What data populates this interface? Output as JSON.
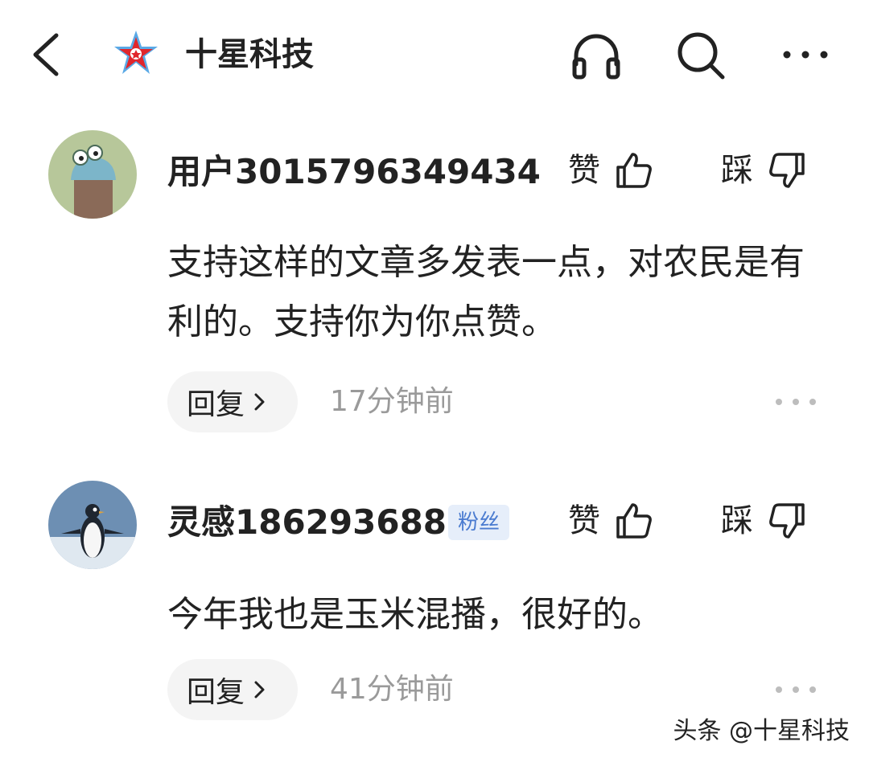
{
  "header": {
    "channel_name": "十星科技",
    "icons": [
      "back-arrow-icon",
      "channel-logo-star",
      "headphones-icon",
      "search-icon",
      "more-dots-icon"
    ]
  },
  "comments": [
    {
      "username": "用户3015796349434",
      "badge": "",
      "like_label": "赞",
      "dislike_label": "踩",
      "text": "支持这样的文章多发表一点，对农民是有利的。支持你为你点赞。",
      "reply_label": "回复",
      "time": "17分钟前",
      "avatar": "cartoon-creature-avatar"
    },
    {
      "username": "灵感186293688",
      "badge": "粉丝",
      "like_label": "赞",
      "dislike_label": "踩",
      "text": "今年我也是玉米混播，很好的。",
      "reply_label": "回复",
      "time": "41分钟前",
      "avatar": "penguin-avatar"
    }
  ],
  "watermark": "头条 @十星科技",
  "colors": {
    "text": "#222222",
    "muted": "#9a9a9a",
    "reply_bg": "#f4f4f4",
    "badge_bg": "#e6eefa",
    "badge_text": "#4a7bd0",
    "logo_red": "#e0262c",
    "logo_blue": "#5aa9e6"
  }
}
